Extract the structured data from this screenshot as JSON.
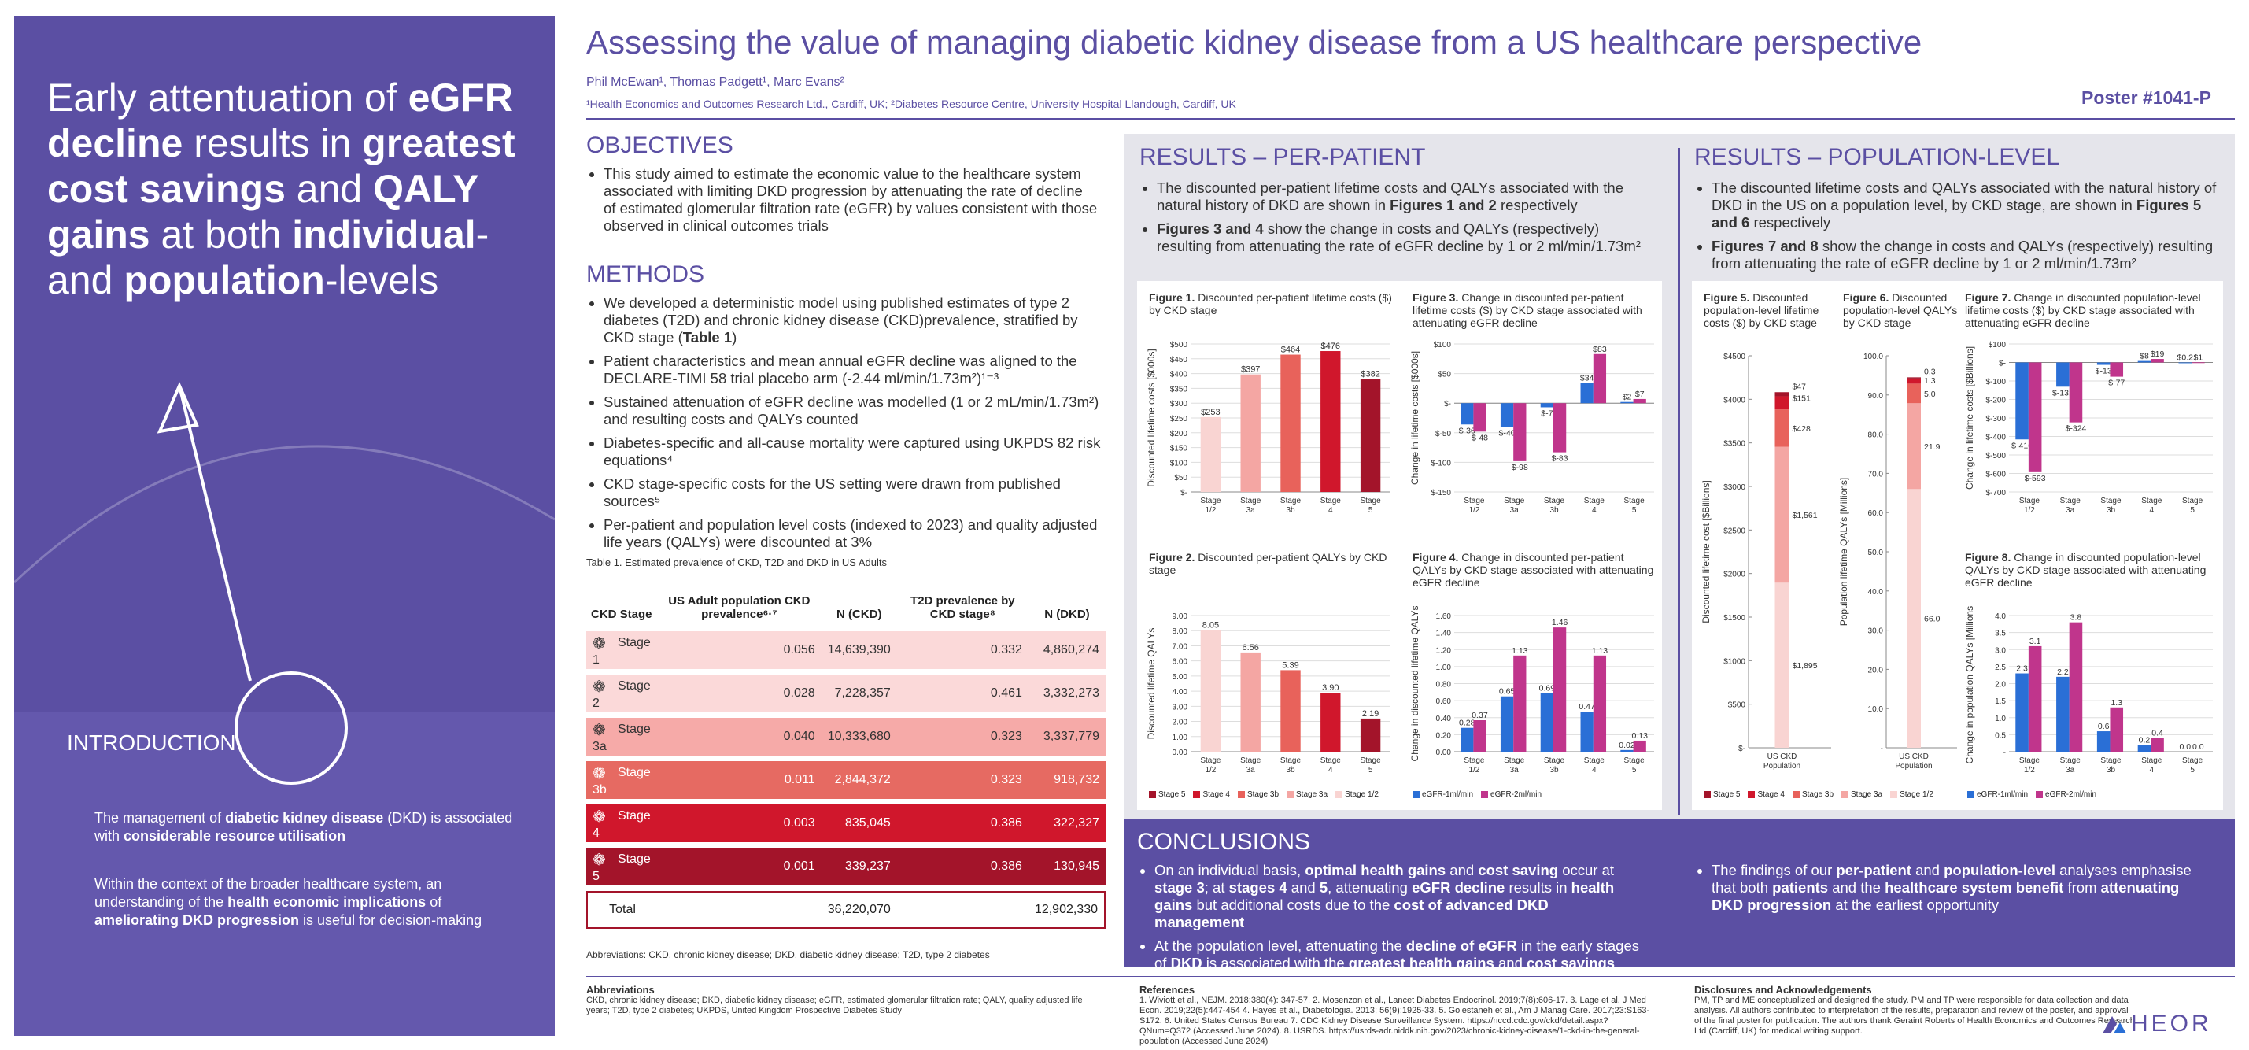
{
  "left": {
    "headline": [
      {
        "t": "Early attentuation of ",
        "b": false
      },
      {
        "t": "eGFR decline",
        "b": true
      },
      {
        "t": " results in ",
        "b": false
      },
      {
        "t": "greatest cost savings",
        "b": true
      },
      {
        "t": " and ",
        "b": false
      },
      {
        "t": "QALY gains",
        "b": true
      },
      {
        "t": " at both ",
        "b": false
      },
      {
        "t": "individual",
        "b": true
      },
      {
        "t": "-and ",
        "b": false
      },
      {
        "t": "population",
        "b": true
      },
      {
        "t": "-levels",
        "b": false
      }
    ],
    "intro_title": "INTRODUCTION",
    "intro_p1": [
      {
        "t": "The management of ",
        "b": false
      },
      {
        "t": "diabetic kidney disease",
        "b": true
      },
      {
        "t": " (DKD) is associated with ",
        "b": false
      },
      {
        "t": "considerable resource utilisation",
        "b": true
      }
    ],
    "intro_p2": [
      {
        "t": "Within the context of the broader healthcare system, an understanding of the ",
        "b": false
      },
      {
        "t": "health economic implications",
        "b": true
      },
      {
        "t": " of ",
        "b": false
      },
      {
        "t": "ameliorating DKD progression",
        "b": true
      },
      {
        "t": " is useful for decision-making",
        "b": false
      }
    ]
  },
  "header": {
    "title": "Assessing the value of managing diabetic kidney disease from a US healthcare perspective",
    "authors": "Phil McEwan¹, Thomas Padgett¹, Marc Evans²",
    "affiliations": "¹Health Economics and Outcomes Research Ltd., Cardiff, UK; ²Diabetes Resource Centre, University Hospital Llandough, Cardiff, UK",
    "poster_no": "Poster #1041-P"
  },
  "objectives": {
    "title": "OBJECTIVES",
    "items": [
      "This study aimed to estimate the economic value to the healthcare system associated with limiting DKD progression by attenuating the rate of decline of estimated glomerular filtration rate (eGFR) by values consistent with those observed in clinical outcomes trials"
    ]
  },
  "methods": {
    "title": "METHODS",
    "items": [
      [
        {
          "t": "We developed a deterministic model using published estimates of type 2 diabetes (T2D) and chronic kidney disease (CKD)prevalence, stratified by CKD stage (",
          "b": false
        },
        {
          "t": "Table 1",
          "b": true
        },
        {
          "t": ")",
          "b": false
        }
      ],
      [
        {
          "t": "Patient characteristics and mean annual eGFR decline was aligned to the DECLARE-TIMI 58 trial placebo arm (-2.44 ml/min/1.73m²)¹⁻³",
          "b": false
        }
      ],
      [
        {
          "t": "Sustained attenuation of eGFR decline was modelled (1 or 2 mL/min/1.73m²) and resulting costs and QALYs counted",
          "b": false
        }
      ],
      [
        {
          "t": "Diabetes-specific and all-cause mortality were captured using UKPDS 82 risk equations⁴",
          "b": false
        }
      ],
      [
        {
          "t": "CKD stage-specific costs for the US setting were drawn from published sources⁵",
          "b": false
        }
      ],
      [
        {
          "t": "Per-patient and population level costs (indexed to 2023) and quality adjusted life years (QALYs) were discounted at 3%",
          "b": false
        }
      ]
    ]
  },
  "table1": {
    "caption": "Table 1. Estimated prevalence of CKD, T2D and DKD in US Adults",
    "headers": [
      "CKD Stage",
      "US Adult population CKD prevalence⁶·⁷",
      "N (CKD)",
      "T2D prevalence by CKD stage⁸",
      "N (DKD)"
    ],
    "rows": [
      {
        "stage": "Stage 1",
        "prev": "0.056",
        "n_ckd": "14,639,390",
        "t2d": "0.332",
        "n_dkd": "4,860,274",
        "color": "#fbd9d9",
        "text": "#333"
      },
      {
        "stage": "Stage 2",
        "prev": "0.028",
        "n_ckd": "7,228,357",
        "t2d": "0.461",
        "n_dkd": "3,332,273",
        "color": "#fbd9d9",
        "text": "#333"
      },
      {
        "stage": "Stage 3a",
        "prev": "0.040",
        "n_ckd": "10,333,680",
        "t2d": "0.323",
        "n_dkd": "3,337,779",
        "color": "#f6aaa8",
        "text": "#333"
      },
      {
        "stage": "Stage 3b",
        "prev": "0.011",
        "n_ckd": "2,844,372",
        "t2d": "0.323",
        "n_dkd": "918,732",
        "color": "#e66a62",
        "text": "#fff"
      },
      {
        "stage": "Stage 4",
        "prev": "0.003",
        "n_ckd": "835,045",
        "t2d": "0.386",
        "n_dkd": "322,327",
        "color": "#d0172c",
        "text": "#fff"
      },
      {
        "stage": "Stage 5",
        "prev": "0.001",
        "n_ckd": "339,237",
        "t2d": "0.386",
        "n_dkd": "130,945",
        "color": "#a3142a",
        "text": "#fff"
      }
    ],
    "total": {
      "label": "Total",
      "n_ckd": "36,220,070",
      "n_dkd": "12,902,330"
    },
    "abbrev": "Abbreviations: CKD, chronic kidney disease; DKD, diabetic kidney disease; T2D, type 2 diabetes"
  },
  "rpp": {
    "title": "RESULTS – PER-PATIENT",
    "items": [
      [
        {
          "t": "The discounted per-patient lifetime costs and QALYs associated with the natural history of DKD are shown in ",
          "b": false
        },
        {
          "t": "Figures 1 and 2",
          "b": true
        },
        {
          "t": " respectively",
          "b": false
        }
      ],
      [
        {
          "t": "Figures 3 and 4",
          "b": true
        },
        {
          "t": " show the change in costs and QALYs (respectively) resulting from attenuating the rate of eGFR decline by 1 or 2 ml/min/1.73m²",
          "b": false
        }
      ]
    ]
  },
  "rpl": {
    "title": "RESULTS – POPULATION-LEVEL",
    "items": [
      [
        {
          "t": "The discounted lifetime costs and QALYs associated with the natural history of DKD in the US on a population level, by CKD stage, are shown in ",
          "b": false
        },
        {
          "t": "Figures 5 and 6",
          "b": true
        },
        {
          "t": " respectively",
          "b": false
        }
      ],
      [
        {
          "t": "Figures 7 and 8",
          "b": true
        },
        {
          "t": " show the change in costs and QALYs (respectively) resulting from attenuating the rate of eGFR decline by 1 or 2 ml/min/1.73m²",
          "b": false
        }
      ]
    ]
  },
  "colors": {
    "s12": "#f9d4d2",
    "s3a": "#f4a6a3",
    "s3b": "#e8625b",
    "s4": "#d0172c",
    "s5": "#a3142a",
    "e1": "#2a6fd6",
    "e2": "#c0358c",
    "purple": "#5b4fa3"
  },
  "legend_stage": [
    "Stage 5",
    "Stage 4",
    "Stage 3b",
    "Stage 3a",
    "Stage 1/2"
  ],
  "legend_egfr": [
    "eGFR-1ml/min",
    "eGFR-2ml/min"
  ],
  "chart_data": [
    {
      "id": "fig1",
      "type": "bar",
      "title": "Figure 1. Discounted per-patient lifetime costs ($) by CKD stage",
      "ylabel": "Discounted lifetime costs [$000s]",
      "categories": [
        "Stage 1/2",
        "Stage 3a",
        "Stage 3b",
        "Stage 4",
        "Stage 5"
      ],
      "values": [
        253,
        397,
        464,
        476,
        382
      ],
      "labels": [
        "$253",
        "$397",
        "$464",
        "$476",
        "$382"
      ],
      "ylim": [
        0,
        500
      ],
      "ticks": [
        "$-",
        "$50",
        "$100",
        "$150",
        "$200",
        "$250",
        "$300",
        "$350",
        "$400",
        "$450",
        "$500"
      ]
    },
    {
      "id": "fig2",
      "type": "bar",
      "title": "Figure 2. Discounted per-patient QALYs by CKD stage",
      "ylabel": "Discounted lifetime QALYs",
      "categories": [
        "Stage 1/2",
        "Stage 3a",
        "Stage 3b",
        "Stage 4",
        "Stage 5"
      ],
      "values": [
        8.05,
        6.56,
        5.39,
        3.9,
        2.19
      ],
      "labels": [
        "8.05",
        "6.56",
        "5.39",
        "3.90",
        "2.19"
      ],
      "ylim": [
        0,
        9
      ],
      "ticks": [
        "0.00",
        "1.00",
        "2.00",
        "3.00",
        "4.00",
        "5.00",
        "6.00",
        "7.00",
        "8.00",
        "9.00"
      ]
    },
    {
      "id": "fig3",
      "type": "bar",
      "title": "Figure 3. Change in discounted per-patient lifetime costs ($) by CKD stage associated with attenuating eGFR decline",
      "ylabel": "Change in lifetime costs [$000s]",
      "categories": [
        "Stage 1/2",
        "Stage 3a",
        "Stage 3b",
        "Stage 4",
        "Stage 5"
      ],
      "series": [
        {
          "name": "eGFR-1ml/min",
          "values": [
            -36,
            -40,
            -7,
            34,
            2
          ],
          "labels": [
            "$-36",
            "$-40",
            "$-7",
            "$34",
            "$2"
          ]
        },
        {
          "name": "eGFR-2ml/min",
          "values": [
            -48,
            -98,
            -83,
            83,
            7
          ],
          "labels": [
            "$-48",
            "$-98",
            "$-83",
            "$83",
            "$7"
          ]
        }
      ],
      "ylim": [
        -150,
        100
      ],
      "ticks": [
        "$-150",
        "$-100",
        "$-50",
        "$-",
        "$50",
        "$100"
      ]
    },
    {
      "id": "fig4",
      "type": "bar",
      "title": "Figure 4. Change in discounted per-patient QALYs by CKD stage associated with attenuating eGFR decline",
      "ylabel": "Change in discounted lifetime QALYs",
      "categories": [
        "Stage 1/2",
        "Stage 3a",
        "Stage 3b",
        "Stage 4",
        "Stage 5"
      ],
      "series": [
        {
          "name": "eGFR-1ml/min",
          "values": [
            0.28,
            0.65,
            0.69,
            0.47,
            0.02
          ],
          "labels": [
            "0.28",
            "0.65",
            "0.69",
            "0.47",
            "0.02"
          ]
        },
        {
          "name": "eGFR-2ml/min",
          "values": [
            0.37,
            1.13,
            1.46,
            1.13,
            0.13
          ],
          "labels": [
            "0.37",
            "1.13",
            "1.46",
            "1.13",
            "0.13"
          ]
        }
      ],
      "ylim": [
        0,
        1.6
      ],
      "ticks": [
        "0.00",
        "0.20",
        "0.40",
        "0.60",
        "0.80",
        "1.00",
        "1.20",
        "1.40",
        "1.60"
      ]
    },
    {
      "id": "fig5",
      "type": "stacked-bar",
      "title": "Figure 5. Discounted population-level lifetime costs ($) by CKD stage",
      "ylabel": "Discounted lifetime cost [$Billions]",
      "categories": [
        "US CKD Population"
      ],
      "stack": [
        {
          "name": "Stage 1/2",
          "value": 1895,
          "label": "$1,895"
        },
        {
          "name": "Stage 3a",
          "value": 1561,
          "label": "$1,561"
        },
        {
          "name": "Stage 3b",
          "value": 428,
          "label": "$428"
        },
        {
          "name": "Stage 4",
          "value": 151,
          "label": "$151"
        },
        {
          "name": "Stage 5",
          "value": 47,
          "label": "$47"
        }
      ],
      "ylim": [
        0,
        4500
      ],
      "ticks": [
        "$-",
        "$500",
        "$1000",
        "$1500",
        "$2000",
        "$2500",
        "$3000",
        "$3500",
        "$4000",
        "$4500"
      ]
    },
    {
      "id": "fig6",
      "type": "stacked-bar",
      "title": "Figure 6. Discounted population-level QALYs by CKD stage",
      "ylabel": "Population lifetime QALYs [Millions]",
      "categories": [
        "US CKD Population"
      ],
      "stack": [
        {
          "name": "Stage 1/2",
          "value": 66.0,
          "label": "66.0"
        },
        {
          "name": "Stage 3a",
          "value": 21.9,
          "label": "21.9"
        },
        {
          "name": "Stage 3b",
          "value": 5.0,
          "label": "5.0"
        },
        {
          "name": "Stage 4",
          "value": 1.3,
          "label": "1.3"
        },
        {
          "name": "Stage 5",
          "value": 0.3,
          "label": "0.3"
        }
      ],
      "ylim": [
        0,
        100
      ],
      "ticks": [
        "-",
        "10.0",
        "20.0",
        "30.0",
        "40.0",
        "50.0",
        "60.0",
        "70.0",
        "80.0",
        "90.0",
        "100.0"
      ]
    },
    {
      "id": "fig7",
      "type": "bar",
      "title": "Figure 7. Change in discounted population-level lifetime costs ($) by CKD stage associated with attenuating eGFR decline",
      "ylabel": "Change in lifetime costs [$Billions]",
      "categories": [
        "Stage 1/2",
        "Stage 3a",
        "Stage 3b",
        "Stage 4",
        "Stage 5"
      ],
      "series": [
        {
          "name": "eGFR-1ml/min",
          "values": [
            -416,
            -131,
            -13,
            8,
            0.2
          ],
          "labels": [
            "$-416",
            "$-131",
            "$-13",
            "$8",
            "$0.2"
          ]
        },
        {
          "name": "eGFR-2ml/min",
          "values": [
            -593,
            -324,
            -77,
            19,
            1
          ],
          "labels": [
            "$-593",
            "$-324",
            "$-77",
            "$19",
            "$1"
          ]
        }
      ],
      "ylim": [
        -700,
        100
      ],
      "ticks": [
        "$-700",
        "$-600",
        "$-500",
        "$-400",
        "$-300",
        "$-200",
        "$-100",
        "$-",
        "$100"
      ]
    },
    {
      "id": "fig8",
      "type": "bar",
      "title": "Figure 8. Change in discounted population-level QALYs by CKD stage associated with attenuating eGFR decline",
      "ylabel": "Change in population QALYs [Millions]",
      "categories": [
        "Stage 1/2",
        "Stage 3a",
        "Stage 3b",
        "Stage 4",
        "Stage 5"
      ],
      "series": [
        {
          "name": "eGFR-1ml/min",
          "values": [
            2.3,
            2.2,
            0.6,
            0.2,
            0.0
          ],
          "labels": [
            "2.3",
            "2.2",
            "0.6",
            "0.2",
            "0.0"
          ]
        },
        {
          "name": "eGFR-2ml/min",
          "values": [
            3.1,
            3.8,
            1.3,
            0.4,
            0.0
          ],
          "labels": [
            "3.1",
            "3.8",
            "1.3",
            "0.4",
            "0.0"
          ]
        }
      ],
      "ylim": [
        0,
        4
      ],
      "ticks": [
        "-",
        "0.5",
        "1.0",
        "1.5",
        "2.0",
        "2.5",
        "3.0",
        "3.5",
        "4.0"
      ]
    }
  ],
  "conclusions": {
    "title": "CONCLUSIONS",
    "left": [
      [
        {
          "t": "On an individual basis, ",
          "b": false
        },
        {
          "t": "optimal health gains",
          "b": true
        },
        {
          "t": " and ",
          "b": false
        },
        {
          "t": "cost saving",
          "b": true
        },
        {
          "t": " occur at ",
          "b": false
        },
        {
          "t": "stage 3",
          "b": true
        },
        {
          "t": "; at ",
          "b": false
        },
        {
          "t": "stages 4",
          "b": true
        },
        {
          "t": " and ",
          "b": false
        },
        {
          "t": "5",
          "b": true
        },
        {
          "t": ", attenuating ",
          "b": false
        },
        {
          "t": "eGFR decline",
          "b": true
        },
        {
          "t": " results in ",
          "b": false
        },
        {
          "t": "health gains",
          "b": true
        },
        {
          "t": " but additional costs due to the ",
          "b": false
        },
        {
          "t": "cost of advanced DKD management",
          "b": true
        }
      ],
      [
        {
          "t": "At the population level, attenuating the ",
          "b": false
        },
        {
          "t": "decline of eGFR",
          "b": true
        },
        {
          "t": " in the early stages of ",
          "b": false
        },
        {
          "t": "DKD",
          "b": true
        },
        {
          "t": " is associated with the ",
          "b": false
        },
        {
          "t": "greatest health gains",
          "b": true
        },
        {
          "t": " and ",
          "b": false
        },
        {
          "t": "cost savings",
          "b": true
        }
      ]
    ],
    "right": [
      [
        {
          "t": "The findings of our ",
          "b": false
        },
        {
          "t": "per-patient",
          "b": true
        },
        {
          "t": " and ",
          "b": false
        },
        {
          "t": "population-level",
          "b": true
        },
        {
          "t": " analyses emphasise that both ",
          "b": false
        },
        {
          "t": "patients",
          "b": true
        },
        {
          "t": " and the ",
          "b": false
        },
        {
          "t": "healthcare system benefit",
          "b": true
        },
        {
          "t": " from ",
          "b": false
        },
        {
          "t": "attenuating DKD progression",
          "b": true
        },
        {
          "t": " at the earliest opportunity",
          "b": false
        }
      ]
    ]
  },
  "footer": {
    "abbr_title": "Abbreviations",
    "abbr_text": "CKD, chronic kidney disease; DKD, diabetic kidney disease; eGFR, estimated glomerular filtration rate; QALY, quality adjusted life years; T2D, type 2 diabetes; UKPDS, United Kingdom Prospective Diabetes Study",
    "ref_title": "References",
    "ref_text": "1. Wiviott et al., NEJM. 2018;380(4): 347-57. 2. Mosenzon et al., Lancet Diabetes Endocrinol. 2019;7(8):606-17. 3. Lage et al. J Med Econ. 2019;22(5):447-454 4. Hayes et al., Diabetologia. 2013; 56(9):1925-33. 5. Golestaneh et al., Am J Manag Care. 2017;23:S163-S172. 6. United States Census Bureau 7. CDC Kidney Disease Surveillance System. https://nccd.cdc.gov/ckd/detail.aspx?QNum=Q372 (Accessed June 2024). 8. USRDS. https://usrds-adr.niddk.nih.gov/2023/chronic-kidney-disease/1-ckd-in-the-general-population (Accessed June 2024)",
    "disc_title": "Disclosures and Acknowledgements",
    "disc_text": "PM, TP and ME conceptualized and designed the study. PM and TP were responsible for data collection and data analysis. All authors contributed to interpretation of the results, preparation and review of the poster, and approval of the final poster for publication. The authors thank Geraint Roberts of Health Economics and Outcomes Research Ltd (Cardiff, UK) for medical writing support.",
    "logo": "HEOR"
  }
}
